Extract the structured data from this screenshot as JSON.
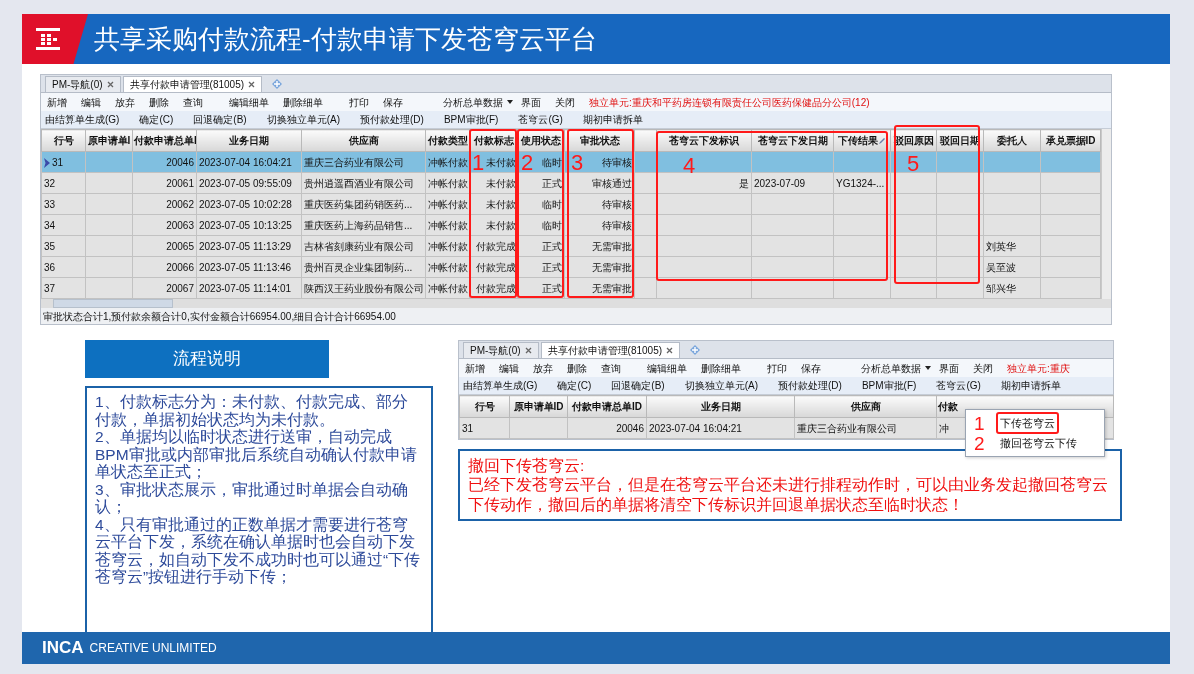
{
  "slide": {
    "title": "共享采购付款流程-付款申请下发苍穹云平台",
    "footer_brand": "INCA",
    "footer_tagline": "CREATIVE UNLIMITED"
  },
  "screenshot_main": {
    "tabs": [
      {
        "label": "PM-导航(0)",
        "selected": false
      },
      {
        "label": "共享付款申请管理(81005)",
        "selected": true
      }
    ],
    "toolbar": [
      {
        "label": "新增"
      },
      {
        "label": "编辑"
      },
      {
        "label": "放弃"
      },
      {
        "label": "删除"
      },
      {
        "label": "查询"
      },
      {
        "label": "编辑细单"
      },
      {
        "label": "删除细单"
      },
      {
        "label": "打印"
      },
      {
        "label": "保存"
      },
      {
        "label": "分析总单数据",
        "dropdown": true
      },
      {
        "label": "界面"
      },
      {
        "label": "关闭"
      }
    ],
    "unit_label": "独立单元:重庆和平药房连锁有限责任公司医药保健品分公司(12)",
    "toolbar2": [
      "由结算单生成(G)",
      "确定(C)",
      "回退确定(B)",
      "切换独立单元(A)",
      "预付款处理(D)",
      "BPM审批(F)",
      "苍穹云(G)",
      "期初申请拆单"
    ],
    "columns": [
      "行号",
      "原申请单I",
      "付款申请总单I",
      "业务日期",
      "供应商",
      "付款类型",
      "付款标志",
      "使用状态",
      "审批状态",
      null,
      "苍穹云下发标识",
      "苍穹云下发日期",
      "下传结果",
      "驳回原因",
      "驳回日期",
      "委托人",
      "承兑票据ID"
    ],
    "rows": [
      {
        "selected": true,
        "cells": [
          "31",
          null,
          "20046",
          "2023-07-04 16:04:21",
          "重庆三合药业有限公司",
          "冲帐付款",
          "未付款",
          "临时",
          "待审核",
          null,
          null,
          null,
          null,
          null,
          null,
          null,
          null
        ]
      },
      {
        "selected": false,
        "cells": [
          "32",
          null,
          "20061",
          "2023-07-05 09:55:09",
          "贵州逍遥酉酒业有限公司",
          "冲帐付款",
          "未付款",
          "正式",
          "审核通过",
          null,
          "是",
          "2023-07-09",
          "YG1324-...",
          null,
          null,
          null,
          null
        ]
      },
      {
        "selected": false,
        "cells": [
          "33",
          null,
          "20062",
          "2023-07-05 10:02:28",
          "重庆医药集团药销医药...",
          "冲帐付款",
          "未付款",
          "临时",
          "待审核",
          null,
          null,
          null,
          null,
          null,
          null,
          null,
          null
        ]
      },
      {
        "selected": false,
        "cells": [
          "34",
          null,
          "20063",
          "2023-07-05 10:13:25",
          "重庆医药上海药品销售...",
          "冲帐付款",
          "未付款",
          "临时",
          "待审核",
          null,
          null,
          null,
          null,
          null,
          null,
          null,
          null
        ]
      },
      {
        "selected": false,
        "cells": [
          "35",
          null,
          "20065",
          "2023-07-05 11:13:29",
          "吉林省刻康药业有限公司",
          "冲帐付款",
          "付款完成",
          "正式",
          "无需审批",
          null,
          null,
          null,
          null,
          null,
          null,
          "刘英华",
          null
        ]
      },
      {
        "selected": false,
        "cells": [
          "36",
          null,
          "20066",
          "2023-07-05 11:13:46",
          "贵州百灵企业集团制药...",
          "冲帐付款",
          "付款完成",
          "正式",
          "无需审批",
          null,
          null,
          null,
          null,
          null,
          null,
          "吴至波",
          null
        ]
      },
      {
        "selected": false,
        "cells": [
          "37",
          null,
          "20067",
          "2023-07-05 11:14:01",
          "陕西汉王药业股份有限公司",
          "冲帐付款",
          "付款完成",
          "正式",
          "无需审批",
          null,
          null,
          null,
          null,
          null,
          null,
          "邹兴华",
          null
        ]
      }
    ],
    "status_bar": "审批状态合计1,预付款余额合计0,实付金额合计66954.00,细目合计合计66954.00",
    "annotations": [
      "1",
      "2",
      "3",
      "4",
      "5"
    ]
  },
  "process_title": "流程说明",
  "process_notes": [
    "1、付款标志分为：未付款、付款完成、部分付款，单据初始状态均为未付款。",
    "2、单据均以临时状态进行送审，自动完成BPM审批或内部审批后系统自动确认付款申请单状态至正式；",
    "3、审批状态展示，审批通过时单据会自动确认；",
    "4、只有审批通过的正数单据才需要进行苍穹云平台下发，系统在确认单据时也会自动下发苍穹云，如自动下发不成功时也可以通过“下传苍穹云”按钮进行手动下传；"
  ],
  "screenshot_menu": {
    "tabs": [
      {
        "label": "PM-导航(0)",
        "selected": false
      },
      {
        "label": "共享付款申请管理(81005)",
        "selected": true
      }
    ],
    "toolbar": [
      {
        "label": "新增"
      },
      {
        "label": "编辑"
      },
      {
        "label": "放弃"
      },
      {
        "label": "删除"
      },
      {
        "label": "查询"
      },
      {
        "label": "编辑细单"
      },
      {
        "label": "删除细单"
      },
      {
        "label": "打印"
      },
      {
        "label": "保存"
      },
      {
        "label": "分析总单数据",
        "dropdown": true
      },
      {
        "label": "界面"
      },
      {
        "label": "关闭"
      }
    ],
    "unit_label": "独立单元:重庆",
    "toolbar2": [
      "由结算单生成(G)",
      "确定(C)",
      "回退确定(B)",
      "切换独立单元(A)",
      "预付款处理(D)",
      "BPM审批(F)",
      "苍穹云(G)",
      "期初申请拆单"
    ],
    "columns": [
      "行号",
      "原申请单ID",
      "付款申请总单ID",
      "业务日期",
      "供应商",
      "付款"
    ],
    "row": {
      "row_no": "31",
      "total_id": "20046",
      "date": "2023-07-04 16:04:21",
      "supplier": "重庆三合药业有限公司",
      "pay_type": "冲"
    },
    "menu": [
      {
        "label": "下传苍穹云",
        "annotation": "1",
        "highlighted": true
      },
      {
        "label": "撤回苍穹云下传",
        "annotation": "2",
        "highlighted": false
      }
    ]
  },
  "withdraw_note": {
    "title": "撤回下传苍穹云:",
    "text": "已经下发苍穹云平台，但是在苍穹云平台还未进行排程动作时，可以由业务发起撤回苍穹云下传动作，撤回后的单据将清空下传标识并回退单据状态至临时状态！"
  }
}
